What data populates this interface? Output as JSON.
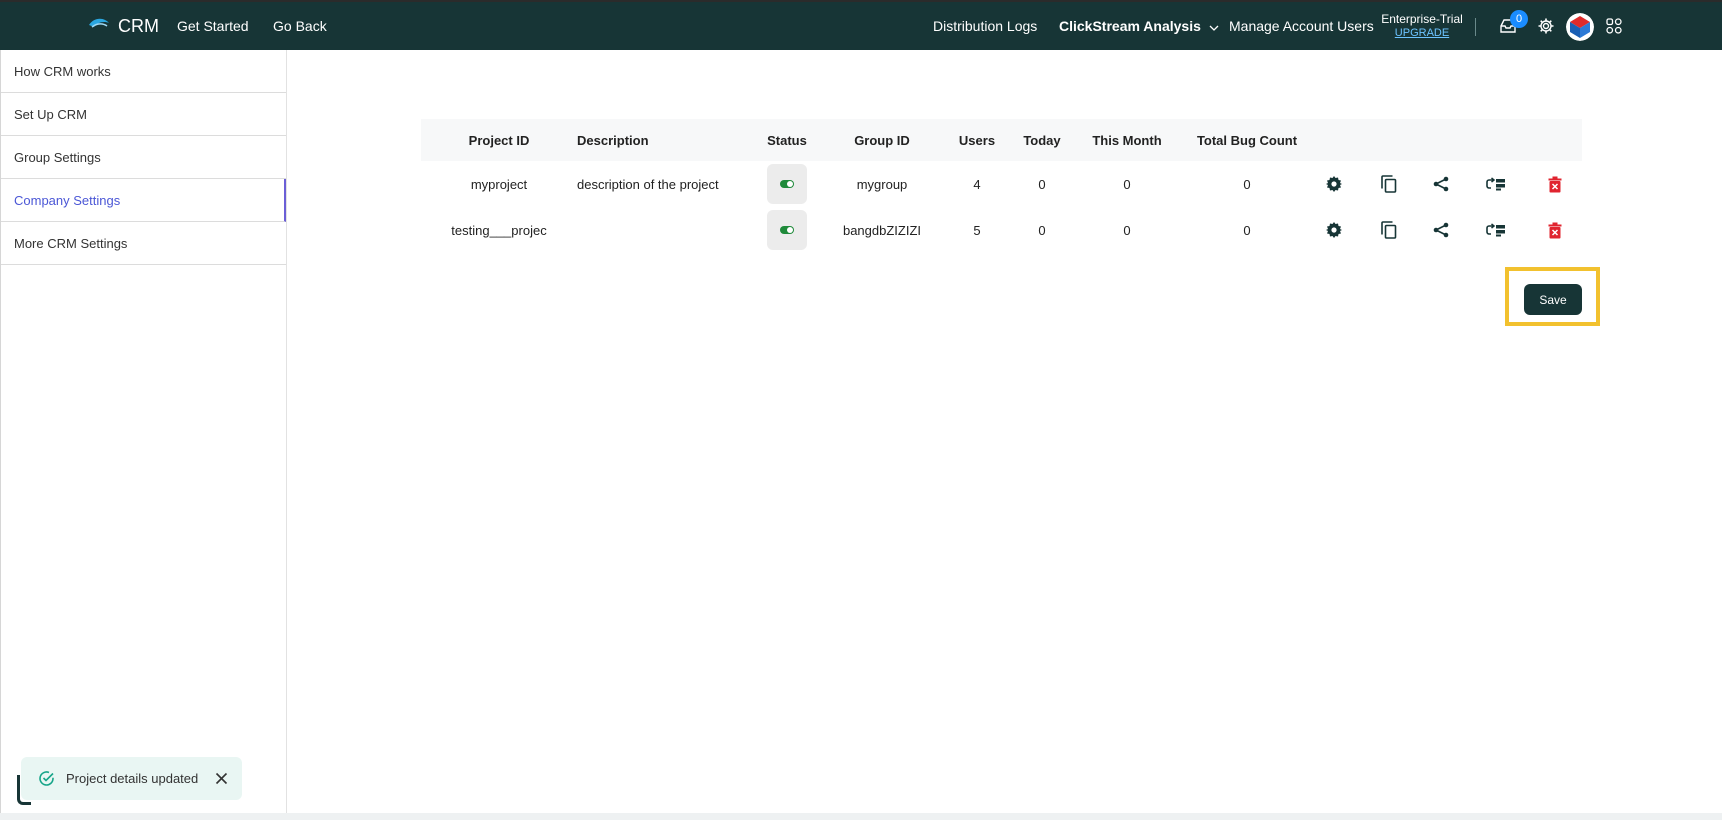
{
  "header": {
    "brand": "CRM",
    "nav_left": [
      "Get Started",
      "Go Back"
    ],
    "nav_right": {
      "distribution_logs": "Distribution Logs",
      "clickstream": "ClickStream Analysis",
      "manage_users": "Manage Account Users"
    },
    "plan": {
      "name": "Enterprise-Trial",
      "upgrade": "UPGRADE"
    },
    "notification_count": "0",
    "icons": [
      "inbox-icon",
      "gear-icon",
      "avatar-logo",
      "apps-grid-icon"
    ]
  },
  "sidebar": {
    "items": [
      {
        "label": "How CRM works",
        "active": false
      },
      {
        "label": "Set Up CRM",
        "active": false
      },
      {
        "label": "Group Settings",
        "active": false
      },
      {
        "label": "Company Settings",
        "active": true
      },
      {
        "label": "More CRM Settings",
        "active": false
      }
    ]
  },
  "table": {
    "columns": [
      "Project ID",
      "Description",
      "Status",
      "Group ID",
      "Users",
      "Today",
      "This Month",
      "Total Bug Count"
    ],
    "rows": [
      {
        "project_id": "myproject",
        "description": "description of the project",
        "status": "on",
        "group_id": "mygroup",
        "users": "4",
        "today": "0",
        "this_month": "0",
        "bug_count": "0"
      },
      {
        "project_id": "testing___projec",
        "description": "",
        "status": "on",
        "group_id": "bangdbZIZIZI",
        "users": "5",
        "today": "0",
        "this_month": "0",
        "bug_count": "0"
      }
    ],
    "row_actions": [
      "settings-icon",
      "copy-icon",
      "share-icon",
      "transfer-icon",
      "delete-icon"
    ]
  },
  "save_label": "Save",
  "toast": {
    "message": "Project details updated"
  },
  "colors": {
    "header_bg": "#173536",
    "active_link": "#4b57d6",
    "toggle_on": "#1f8a3a",
    "delete": "#e0242f",
    "highlight": "#f2c12e"
  }
}
